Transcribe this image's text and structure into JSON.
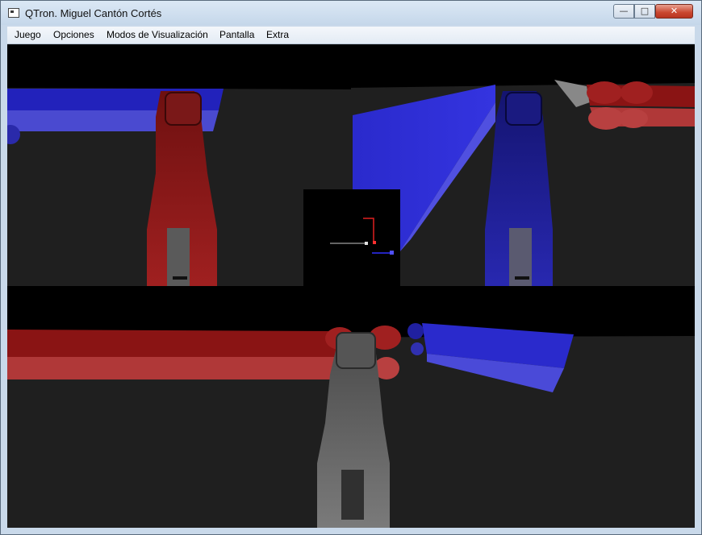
{
  "window": {
    "title": "QTron. Miguel Cantón Cortés"
  },
  "controls": {
    "minimize": "—",
    "maximize": "□",
    "close": "✕"
  },
  "menu": {
    "items": [
      "Juego",
      "Opciones",
      "Modos de Visualización",
      "Pantalla",
      "Extra"
    ]
  },
  "colors": {
    "red_player": "#8e1a1a",
    "blue_player": "#1e1e9a",
    "grey_player": "#6a6a6a",
    "floor": "#1f1f1f"
  }
}
